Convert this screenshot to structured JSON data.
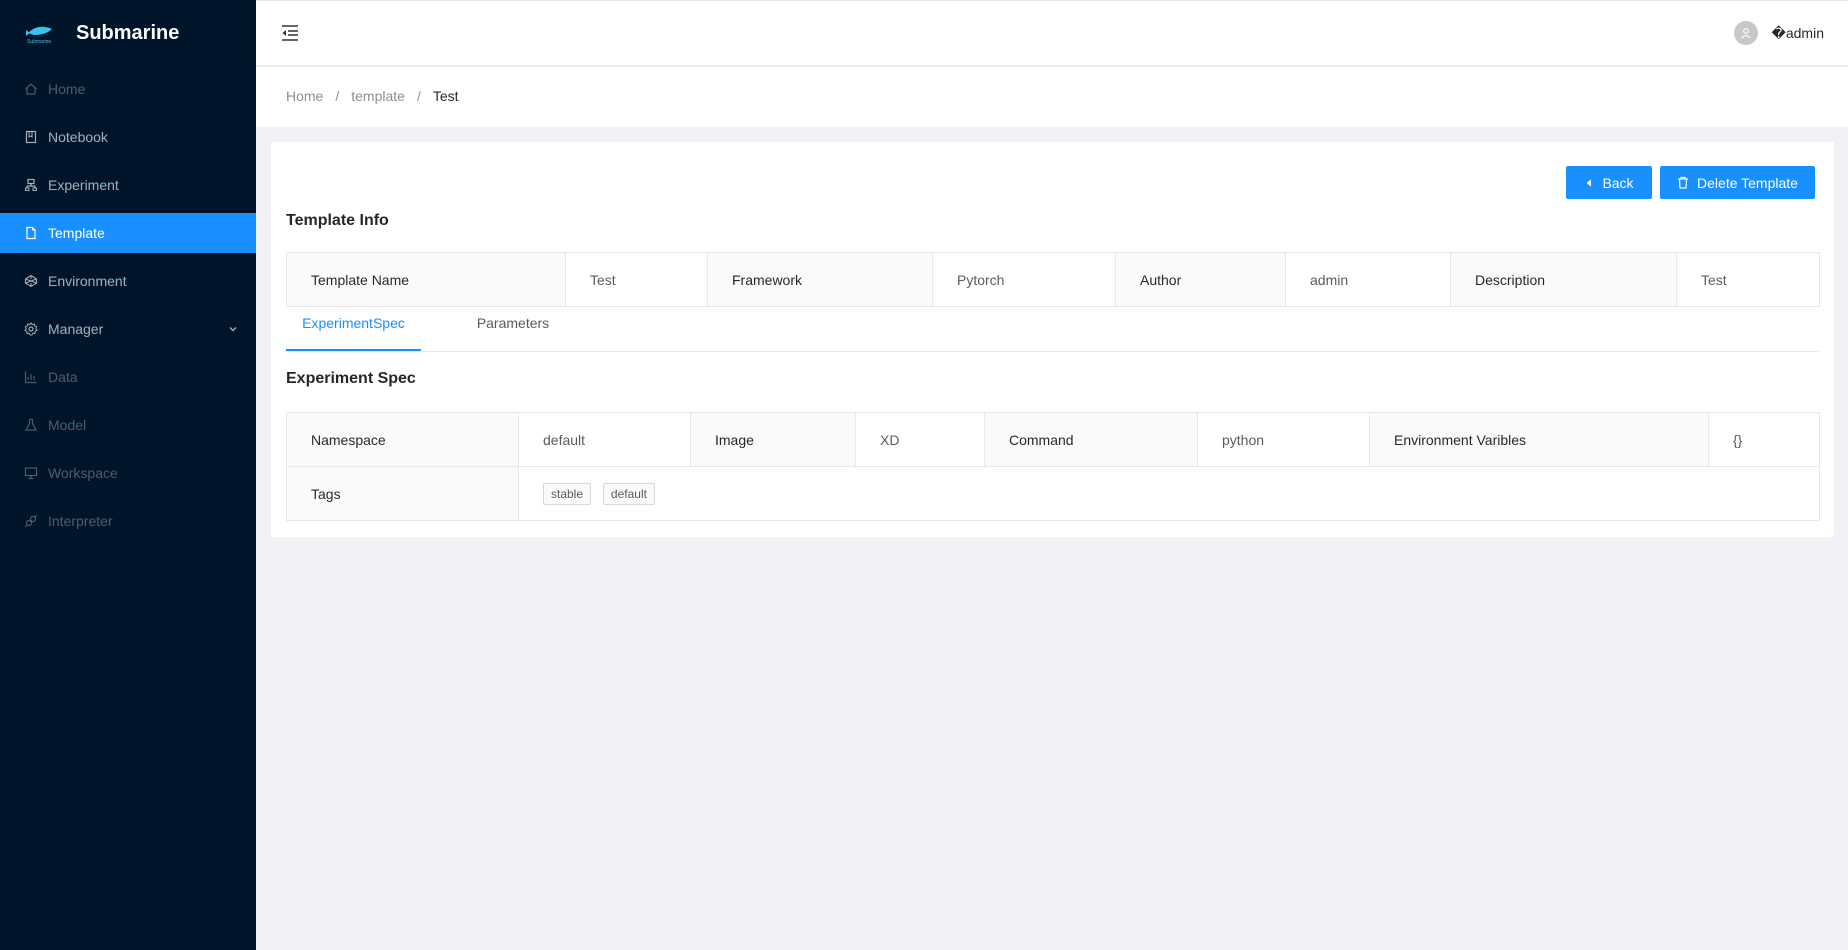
{
  "app": {
    "title": "Submarine"
  },
  "sidebar": {
    "items": [
      {
        "label": "Home",
        "icon": "home-icon",
        "state": "disabled"
      },
      {
        "label": "Notebook",
        "icon": "book-icon",
        "state": "normal"
      },
      {
        "label": "Experiment",
        "icon": "cluster-icon",
        "state": "normal"
      },
      {
        "label": "Template",
        "icon": "file-icon",
        "state": "active"
      },
      {
        "label": "Environment",
        "icon": "codepen-icon",
        "state": "normal"
      },
      {
        "label": "Manager",
        "icon": "setting-icon",
        "state": "normal",
        "has_submenu": true
      },
      {
        "label": "Data",
        "icon": "bar-chart-icon",
        "state": "disabled"
      },
      {
        "label": "Model",
        "icon": "experiment-icon",
        "state": "disabled"
      },
      {
        "label": "Workspace",
        "icon": "desktop-icon",
        "state": "disabled"
      },
      {
        "label": "Interpreter",
        "icon": "api-icon",
        "state": "disabled"
      }
    ]
  },
  "header": {
    "user_name": "�admin"
  },
  "breadcrumb": {
    "items": [
      "Home",
      "template",
      "Test"
    ],
    "separator": "/"
  },
  "actions": {
    "back_label": "Back",
    "delete_label": "Delete Template"
  },
  "template_info": {
    "title": "Template Info",
    "fields": [
      {
        "label": "Template Name",
        "value": "Test"
      },
      {
        "label": "Framework",
        "value": "Pytorch"
      },
      {
        "label": "Author",
        "value": "admin"
      },
      {
        "label": "Description",
        "value": "Test"
      }
    ]
  },
  "tabs": [
    {
      "label": "ExperimentSpec",
      "active": true
    },
    {
      "label": "Parameters",
      "active": false
    }
  ],
  "experiment_spec": {
    "title": "Experiment Spec",
    "fields": [
      {
        "label": "Namespace",
        "value": "default"
      },
      {
        "label": "Image",
        "value": "XD"
      },
      {
        "label": "Command",
        "value": "python"
      },
      {
        "label": "Environment Varibles",
        "value": "{}"
      }
    ],
    "tags_label": "Tags",
    "tags": [
      "stable",
      "default"
    ]
  },
  "colors": {
    "primary": "#1890ff",
    "sidebar_bg": "#001529",
    "page_bg": "#f0f2f5"
  }
}
